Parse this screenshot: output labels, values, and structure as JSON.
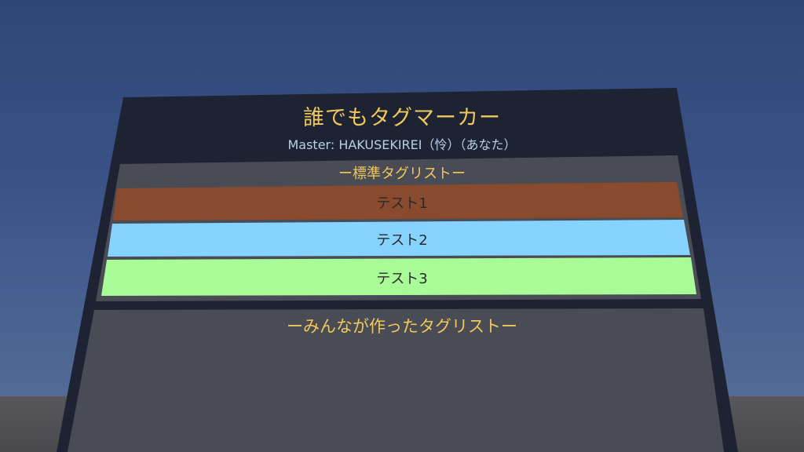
{
  "panel": {
    "title": "誰でもタグマーカー",
    "master": "Master: HAKUSEKIREI（怜）（あなた）"
  },
  "standard_list": {
    "title": "ー標準タグリストー",
    "tags": [
      {
        "label": "テスト1",
        "color": "#8a4a2e"
      },
      {
        "label": "テスト2",
        "color": "#86d3ff"
      },
      {
        "label": "テスト3",
        "color": "#a9fb97"
      }
    ]
  },
  "user_list": {
    "title": "ーみんなが作ったタグリストー"
  }
}
